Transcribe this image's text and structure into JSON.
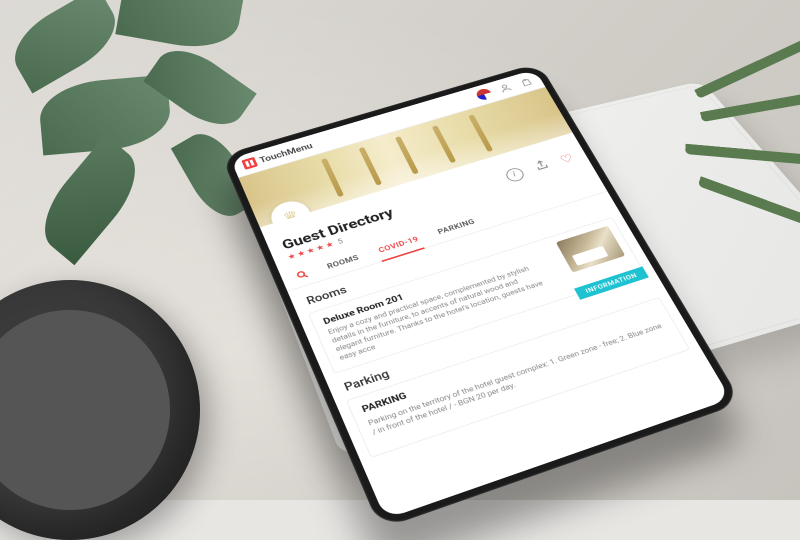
{
  "topbar": {
    "brand": "TouchMenu"
  },
  "page": {
    "title": "Guest Directory",
    "rating_value": "5"
  },
  "tabs": {
    "items": [
      {
        "label": "ROOMS",
        "active": false
      },
      {
        "label": "COVID-19",
        "active": true
      },
      {
        "label": "PARKING",
        "active": false
      }
    ]
  },
  "sections": {
    "rooms": {
      "heading": "Rooms",
      "card": {
        "title": "Deluxe Room 201",
        "desc": "Enjoy a cozy and practical space, complemented by stylish details in the furniture, to accents of natural wood and elegant furniture. Thanks to the hotel's location, guests have easy acce",
        "badge": "INFORMATION"
      }
    },
    "parking": {
      "heading": "Parking",
      "card": {
        "title": "PARKING",
        "desc": "Parking on the territory of the hotel guest complex: 1. Green zone - free; 2. Blue zone / in front of the hotel / - BGN 20 per day."
      }
    }
  },
  "icons": {
    "crown": "♕",
    "star": "★",
    "search": "🔍",
    "info": "i",
    "share": "⤴",
    "heart": "♡",
    "user": "👤",
    "bag": "🛍"
  },
  "colors": {
    "accent": "#e44",
    "badge": "#1fc2d1"
  }
}
